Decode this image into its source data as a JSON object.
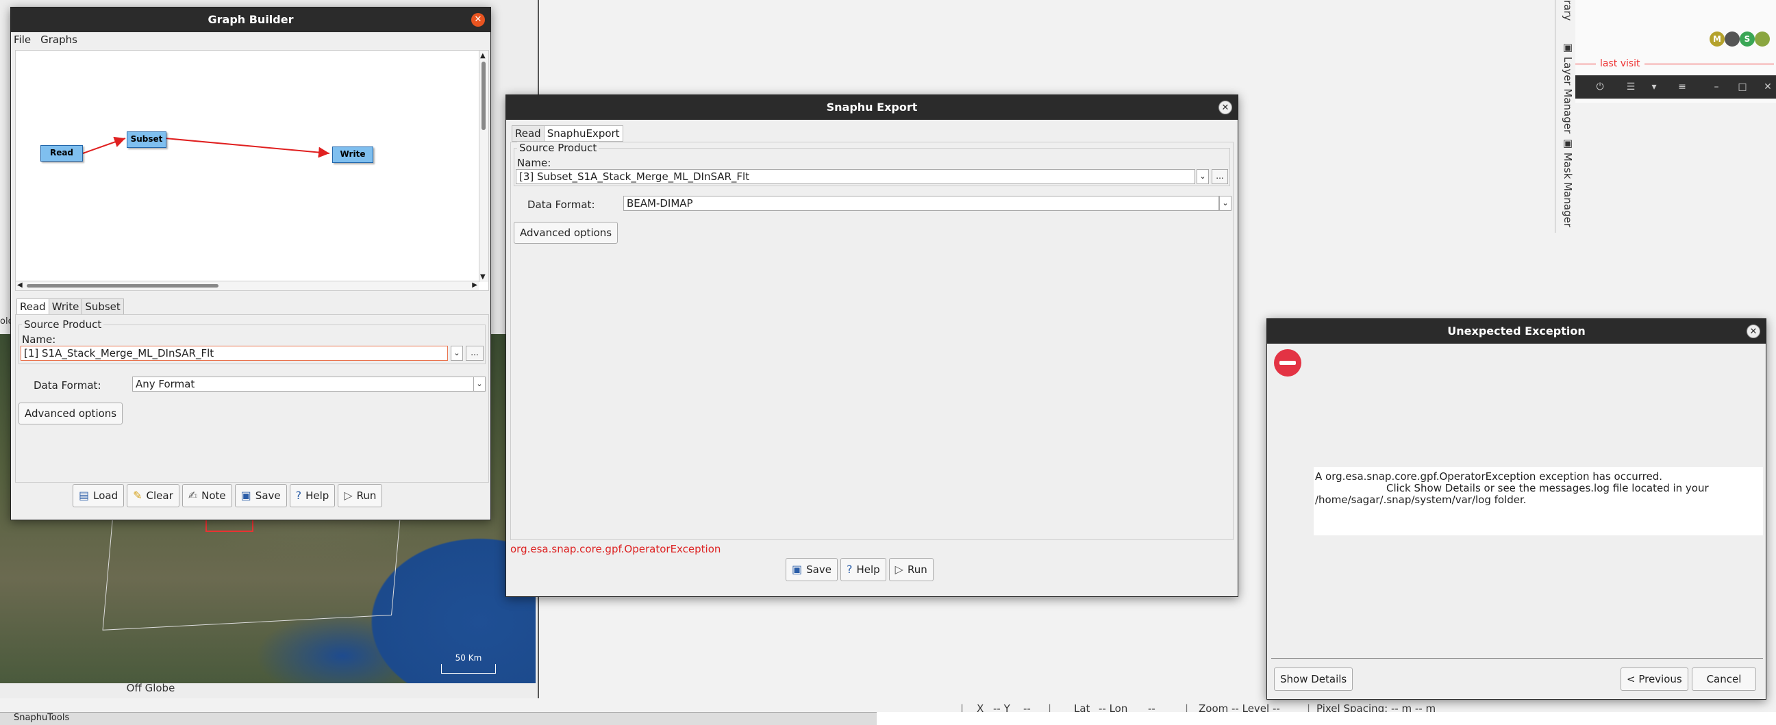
{
  "background": {
    "map_off_globe": "Off Globe",
    "map_scale": "50 Km",
    "left_cut_label": "olo",
    "right_tabs": [
      "rary",
      "Layer Manager",
      "Mask Manager"
    ],
    "last_visit": "last visit",
    "avatars": [
      {
        "letter": "M",
        "color": "#b5a22c"
      },
      {
        "letter": "",
        "color": "#555555"
      },
      {
        "letter": "S",
        "color": "#3aa655"
      },
      {
        "letter": "",
        "color": "#8aa640"
      }
    ],
    "statusbar": {
      "x": "X",
      "x_val": "-- Y",
      "y_val": "--",
      "lat": "Lat",
      "lat_val": "-- Lon",
      "lon_val": "--",
      "zoom": "Zoom -- Level --",
      "pixel_spacing": "Pixel Spacing: -- m -- m"
    },
    "bottom_tab": "SnaphuTools"
  },
  "graph_builder": {
    "title": "Graph Builder",
    "menu": [
      "File",
      "Graphs"
    ],
    "nodes": {
      "read": "Read",
      "subset": "Subset",
      "write": "Write"
    },
    "tabs": [
      "Read",
      "Write",
      "Subset"
    ],
    "source_product": "Source Product",
    "name_label": "Name:",
    "name_value": "[1] S1A_Stack_Merge_ML_DInSAR_Flt",
    "browse": "...",
    "data_format_label": "Data Format:",
    "data_format_value": "Any Format",
    "advanced": "Advanced options",
    "buttons": {
      "load": "Load",
      "clear": "Clear",
      "note": "Note",
      "save": "Save",
      "help": "Help",
      "run": "Run"
    }
  },
  "snaphu_export": {
    "title": "Snaphu Export",
    "tabs": [
      "Read",
      "SnaphuExport"
    ],
    "source_product": "Source Product",
    "name_label": "Name:",
    "name_value": "[3] Subset_S1A_Stack_Merge_ML_DInSAR_Flt",
    "browse": "...",
    "data_format_label": "Data Format:",
    "data_format_value": "BEAM-DIMAP",
    "advanced": "Advanced options",
    "error": "org.esa.snap.core.gpf.OperatorException",
    "buttons": {
      "save": "Save",
      "help": "Help",
      "run": "Run"
    }
  },
  "exception_dialog": {
    "title": "Unexpected Exception",
    "message_line1": "A org.esa.snap.core.gpf.OperatorException exception has occurred.",
    "message_line2": "Click Show Details or see the messages.log file located in your",
    "message_line3": "/home/sagar/.snap/system/var/log folder.",
    "show_details": "Show Details",
    "previous": "< Previous",
    "cancel": "Cancel"
  }
}
